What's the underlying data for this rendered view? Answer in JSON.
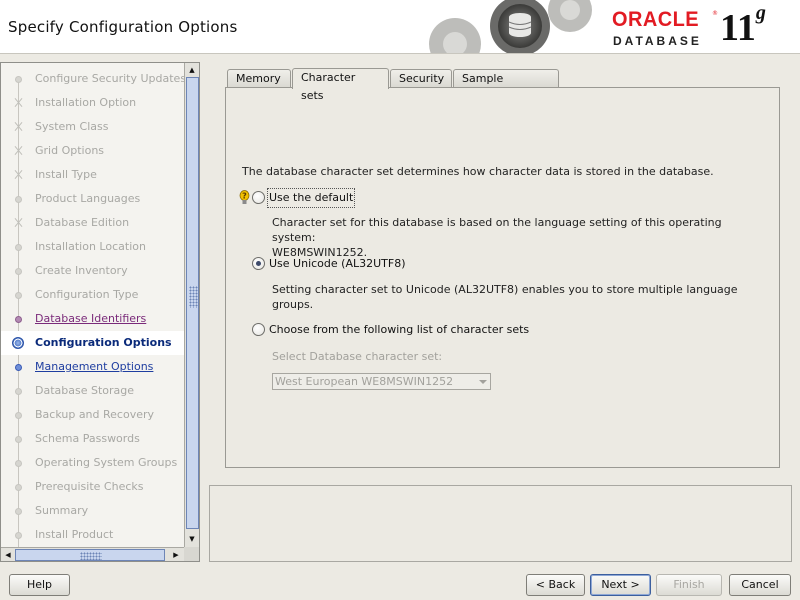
{
  "header": {
    "title": "Specify Configuration Options",
    "logo_brand": "ORACLE",
    "logo_product": "DATABASE",
    "logo_version": "11",
    "logo_version_suffix": "g"
  },
  "nav": {
    "items": [
      {
        "label": "Configure Security Updates",
        "state": "pending"
      },
      {
        "label": "Installation Option",
        "state": "pending"
      },
      {
        "label": "System Class",
        "state": "pending"
      },
      {
        "label": "Grid Options",
        "state": "pending"
      },
      {
        "label": "Install Type",
        "state": "pending"
      },
      {
        "label": "Product Languages",
        "state": "pending"
      },
      {
        "label": "Database Edition",
        "state": "pending"
      },
      {
        "label": "Installation Location",
        "state": "pending"
      },
      {
        "label": "Create Inventory",
        "state": "pending"
      },
      {
        "label": "Configuration Type",
        "state": "pending"
      },
      {
        "label": "Database Identifiers",
        "state": "visited"
      },
      {
        "label": "Configuration Options",
        "state": "current"
      },
      {
        "label": "Management Options",
        "state": "link"
      },
      {
        "label": "Database Storage",
        "state": "pending"
      },
      {
        "label": "Backup and Recovery",
        "state": "pending"
      },
      {
        "label": "Schema Passwords",
        "state": "pending"
      },
      {
        "label": "Operating System Groups",
        "state": "pending"
      },
      {
        "label": "Prerequisite Checks",
        "state": "pending"
      },
      {
        "label": "Summary",
        "state": "pending"
      },
      {
        "label": "Install Product",
        "state": "pending"
      }
    ]
  },
  "tabs": [
    {
      "label": "Memory",
      "active": false
    },
    {
      "label": "Character sets",
      "active": true
    },
    {
      "label": "Security",
      "active": false
    },
    {
      "label": "Sample Schemas",
      "active": false
    }
  ],
  "charset": {
    "description": "The database character set determines how character data is stored in the database.",
    "options": [
      {
        "label": "Use the default",
        "selected": false
      },
      {
        "label": "Use Unicode (AL32UTF8)",
        "selected": true
      },
      {
        "label": "Choose from the following list of character sets",
        "selected": false
      }
    ],
    "default_help_line1": "Character set for this database is based on the language setting of this operating system:",
    "default_help_line2": "WE8MSWIN1252.",
    "unicode_help": "Setting character set to Unicode (AL32UTF8) enables you to store multiple language groups.",
    "select_label": "Select Database character set:",
    "select_value": "West European WE8MSWIN1252"
  },
  "buttons": {
    "help": "Help",
    "back": "< Back",
    "next": "Next >",
    "finish": "Finish",
    "cancel": "Cancel"
  },
  "colors": {
    "oracle_red": "#e21b23",
    "current_step": "#0a2a7a",
    "link": "#1f3ea0"
  }
}
